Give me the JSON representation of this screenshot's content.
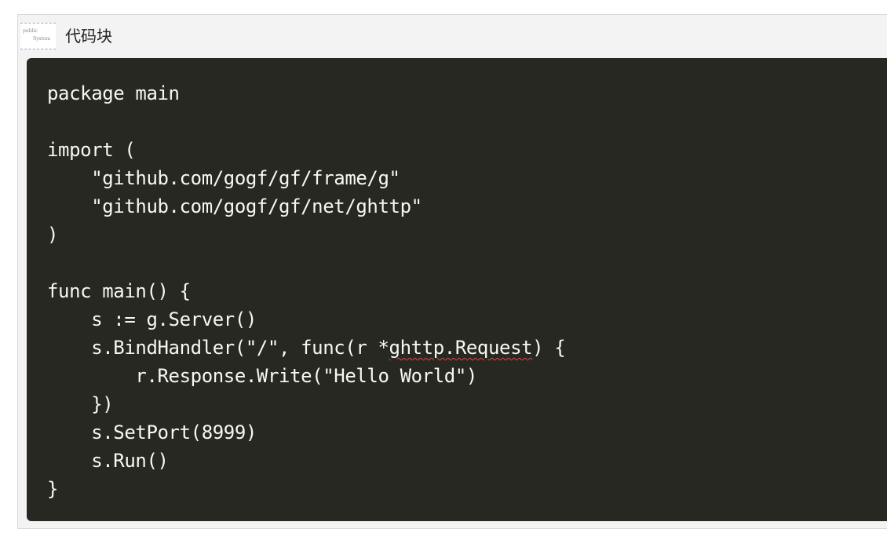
{
  "panel": {
    "title": "代码块",
    "thumbnail": {
      "line1": "public ",
      "line2": "System"
    }
  },
  "code": {
    "language": "go",
    "lines": [
      "package main",
      "",
      "import (",
      "    \"github.com/gogf/gf/frame/g\"",
      "    \"github.com/gogf/gf/net/ghttp\"",
      ")",
      "",
      "func main() {",
      "    s := g.Server()",
      "    s.BindHandler(\"/\", func(r *ghttp.Request) {",
      "        r.Response.Write(\"Hello World\")",
      "    })",
      "    s.SetPort(8999)",
      "    s.Run()",
      "}"
    ],
    "line9_parts": {
      "before": "    s.BindHandler(\"/\", func(r *",
      "flagged": "ghttp.Request",
      "after": ") {"
    }
  },
  "colors": {
    "code_background": "#272822",
    "code_text": "#f8f8f2",
    "spellcheck_underline": "#e0463e",
    "panel_background": "#f3f3f3"
  }
}
